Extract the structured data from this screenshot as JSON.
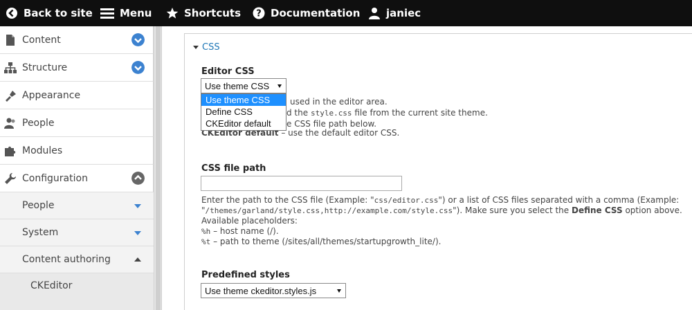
{
  "toolbar": {
    "back": "Back to site",
    "menu": "Menu",
    "shortcuts": "Shortcuts",
    "documentation": "Documentation",
    "user": "janiec"
  },
  "sidebar": {
    "items": [
      {
        "label": "Content",
        "icon": "page-icon"
      },
      {
        "label": "Structure",
        "icon": "sitemap-icon"
      },
      {
        "label": "Appearance",
        "icon": "brush-icon"
      },
      {
        "label": "People",
        "icon": "people-icon"
      },
      {
        "label": "Modules",
        "icon": "puzzle-icon"
      },
      {
        "label": "Configuration",
        "icon": "wrench-icon"
      }
    ],
    "sub": [
      {
        "label": "People"
      },
      {
        "label": "System"
      },
      {
        "label": "Content authoring"
      },
      {
        "label": "CKEditor"
      }
    ],
    "accent": "#3c82d0"
  },
  "css_section": {
    "legend": "CSS",
    "editor_css_label": "Editor CSS",
    "editor_css_selected": "Use theme CSS",
    "options": [
      "Use theme CSS",
      "Define CSS",
      "CKEditor default"
    ],
    "desc_line1_tail": "used in the editor area.",
    "desc_line2_tail_a": "d the ",
    "desc_line2_code": "style.css",
    "desc_line2_tail_b": " file from the current site theme.",
    "desc_line3_tail": "e CSS file path below.",
    "desc_line4_bold": "CKEditor default",
    "desc_line4_rest": " – use the default editor CSS.",
    "css_path_label": "CSS file path",
    "css_path_value": "",
    "path_desc_1a": "Enter the path to the CSS file (Example: \"",
    "path_desc_1code": "css/editor.css",
    "path_desc_1b": "\") or a list of CSS files separated with a comma (Example:",
    "path_desc_2a": "\"",
    "path_desc_2code": "/themes/garland/style.css,http://example.com/style.css",
    "path_desc_2b": "\"). Make sure you select the ",
    "path_desc_2bold": "Define CSS",
    "path_desc_2c": " option above.",
    "path_desc_3": "Available placeholders:",
    "path_desc_4code": "%h",
    "path_desc_4": " – host name (/).",
    "path_desc_5code": "%t",
    "path_desc_5": " – path to theme (/sites/all/themes/startupgrowth_lite/).",
    "predef_label": "Predefined styles",
    "predef_selected": "Use theme ckeditor.styles.js"
  }
}
